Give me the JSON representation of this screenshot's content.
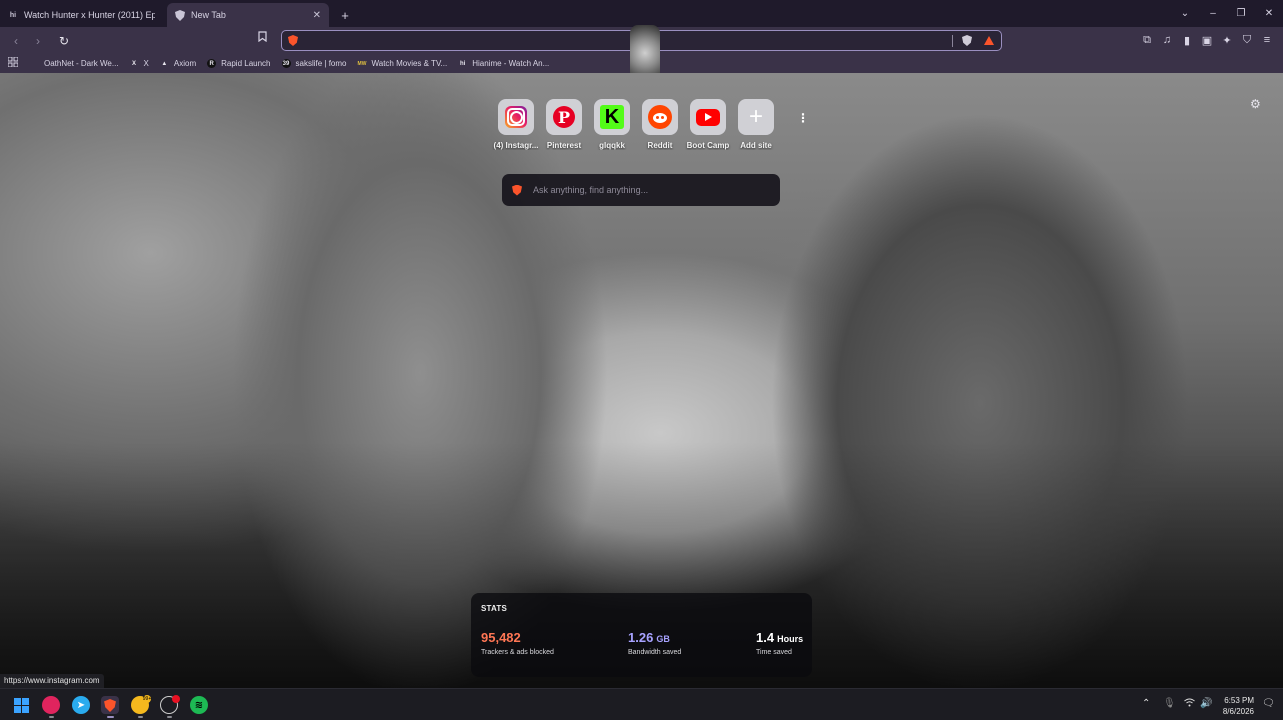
{
  "tabs": [
    {
      "favicon": "hi",
      "title": "Watch Hunter x Hunter (2011) Episod",
      "active": false
    },
    {
      "favicon": "shield-icon",
      "title": "New Tab",
      "active": true
    }
  ],
  "new_tab_symbol": "+",
  "window_controls": {
    "dropdown": "⌄",
    "minimize": "–",
    "maximize": "❐",
    "close": "✕"
  },
  "toolbar": {
    "back": "‹",
    "forward": "›",
    "reload": "↻",
    "bookmark": "🔖",
    "address_value": ""
  },
  "right_icons": [
    "puzzle-icon",
    "music-icon",
    "sidebar-icon",
    "wallet-icon",
    "leo-icon",
    "vpn-icon",
    "menu-icon"
  ],
  "right_icon_glyphs": [
    "⧉",
    "♫",
    "▮",
    "▣",
    "✦",
    "⛉",
    "≡"
  ],
  "bookmarks": [
    {
      "icon": "",
      "label": "OathNet - Dark We..."
    },
    {
      "icon": "X",
      "label": "X"
    },
    {
      "icon": "▲",
      "label": "Axiom"
    },
    {
      "icon": "R",
      "label": "Rapid Launch"
    },
    {
      "icon": "39",
      "label": "sakslife | fomo"
    },
    {
      "icon": "MW",
      "label": "Watch Movies & TV..."
    },
    {
      "icon": "hi",
      "label": "Hianime - Watch An..."
    }
  ],
  "top_sites": [
    {
      "id": "instagram",
      "label": "(4) Instagr..."
    },
    {
      "id": "pinterest",
      "label": "Pinterest"
    },
    {
      "id": "kick",
      "label": "glqqkk"
    },
    {
      "id": "reddit",
      "label": "Reddit"
    },
    {
      "id": "youtube",
      "label": "Boot Camp"
    },
    {
      "id": "add",
      "label": "Add site"
    }
  ],
  "search": {
    "placeholder": "Ask anything, find anything..."
  },
  "stats": {
    "header": "STATS",
    "trackers": {
      "value": "95,482",
      "unit": "",
      "caption": "Trackers & ads blocked",
      "color": "#ff7654"
    },
    "bandwidth": {
      "value": "1.26",
      "unit": "GB",
      "caption": "Bandwidth saved",
      "color": "#a7a2ff"
    },
    "time": {
      "value": "1.4",
      "unit": "Hours",
      "caption": "Time saved",
      "color": "#ffffff"
    }
  },
  "status_url": "https://www.instagram.com",
  "taskbar": {
    "badge_count": "99+",
    "clock_time": "6:53 PM",
    "clock_date": "8/6/2026"
  }
}
